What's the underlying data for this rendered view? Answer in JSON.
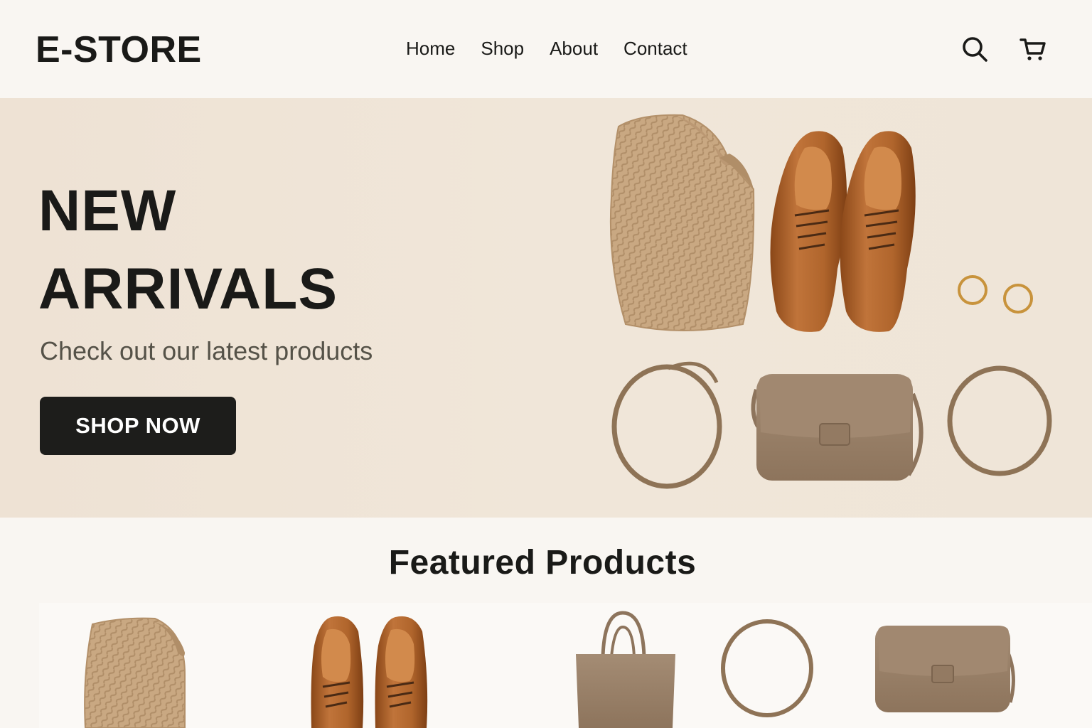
{
  "header": {
    "logo": "E-STORE",
    "nav": [
      "Home",
      "Shop",
      "About",
      "Contact"
    ],
    "icons": [
      "search-icon",
      "cart-icon"
    ]
  },
  "hero": {
    "title_line1": "NEW",
    "title_line2": "ARRIVALS",
    "subtitle": "Check out our latest products",
    "cta_label": "SHOP NOW",
    "items": [
      "knit-sweater",
      "leather-shoes",
      "gold-hoop-earrings",
      "bag-strap",
      "crossbody-bag",
      "bracelet"
    ]
  },
  "featured": {
    "title": "Featured Products",
    "products": [
      "knit-sweater",
      "leather-shoes",
      "tote-bag",
      "bag-strap",
      "crossbody-bag"
    ]
  },
  "colors": {
    "background": "#f9f6f2",
    "hero_background": "#efe5d8",
    "text": "#1a1a18",
    "button": "#1d1d1b",
    "leather": "#b0652c",
    "taupe": "#9a8168",
    "knit": "#c9a882",
    "gold": "#c8933c"
  }
}
